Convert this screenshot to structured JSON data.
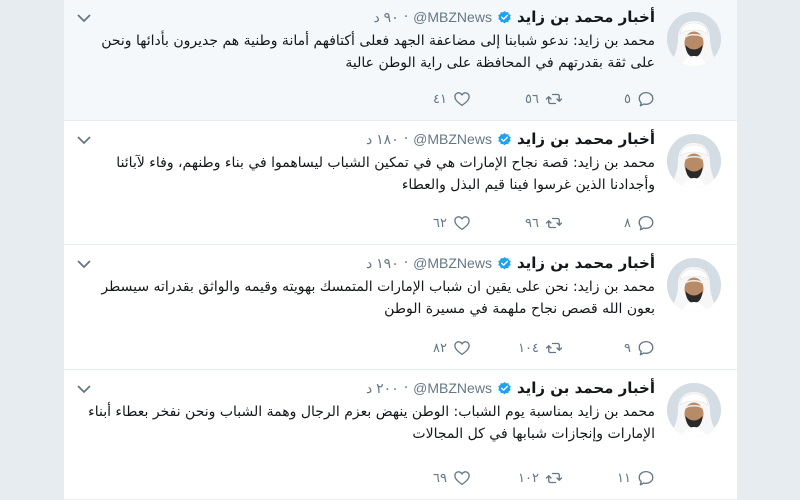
{
  "colors": {
    "page_bg": "#e6ecf0",
    "card_bg": "#ffffff",
    "highlight_bg": "#f5f8fa",
    "verified": "#1da1f2",
    "muted": "#657786",
    "text": "#14171a"
  },
  "tweets": [
    {
      "name": "أخبار محمد بن زايد",
      "handle": "@MBZNews",
      "time": "٩٠ د",
      "text": "محمد بن زايد: ندعو شبابنا إلى مضاعفة الجهد فعلى أكتافهم أمانة وطنية هم جديرون بأدائها ونحن على ثقة بقدرتهم في المحافظة على راية الوطن عالية",
      "replies": "٥",
      "retweets": "٥٦",
      "likes": "٤١"
    },
    {
      "name": "أخبار محمد بن زايد",
      "handle": "@MBZNews",
      "time": "١٨٠ د",
      "text": "محمد بن زايد: قصة نجاح الإمارات هي في تمكين الشباب ليساهموا في بناء وطنهم، وفاء لآبائنا وأجدادنا الذين غرسوا فينا قيم البذل والعطاء",
      "replies": "٨",
      "retweets": "٩٦",
      "likes": "٦٢"
    },
    {
      "name": "أخبار محمد بن زايد",
      "handle": "@MBZNews",
      "time": "١٩٠ د",
      "text": "محمد بن زايد: نحن على يقين ان شباب الإمارات المتمسك بهويته وقيمه والواثق بقدراته سيسطر بعون الله قصص نجاح ملهمة في مسيرة الوطن",
      "replies": "٩",
      "retweets": "١٠٤",
      "likes": "٨٢"
    },
    {
      "name": "أخبار محمد بن زايد",
      "handle": "@MBZNews",
      "time": "٢٠٠ د",
      "text": "محمد بن زايد بمناسبة يوم الشباب: الوطن ينهض بعزم الرجال وهمة الشباب ونحن نفخر بعطاء أبناء الإمارات وإنجازات شبابها في كل المجالات",
      "replies": "١١",
      "retweets": "١٠٢",
      "likes": "٦٩"
    }
  ]
}
